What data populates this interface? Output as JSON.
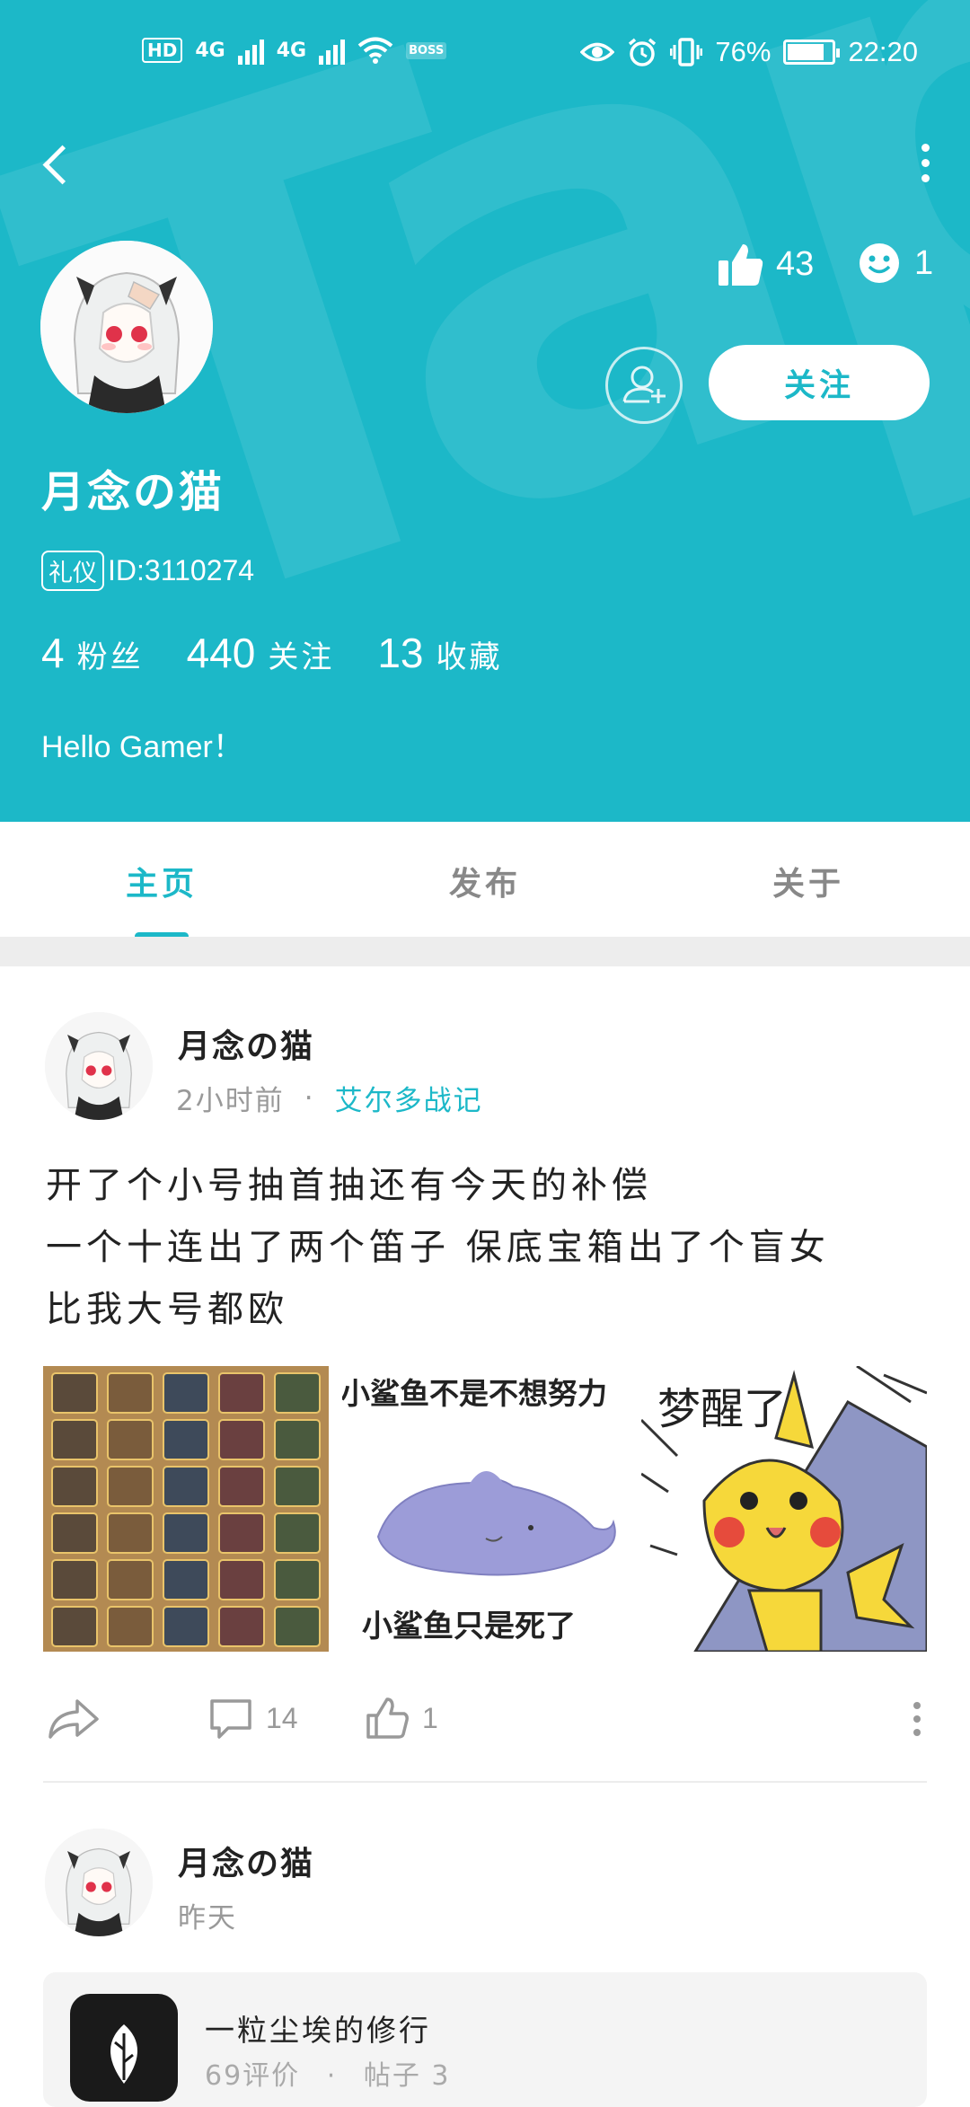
{
  "status_bar": {
    "left_badges": [
      "HD",
      "4G",
      "4G",
      "BOSS"
    ],
    "battery": "76%",
    "time": "22:20"
  },
  "profile": {
    "likes": "43",
    "smiles": "1",
    "follow_label": "关注",
    "username": "月念の猫",
    "tag": "礼仪",
    "id_text": "ID:3110274",
    "stats": [
      {
        "value": "4",
        "label": "粉丝"
      },
      {
        "value": "440",
        "label": "关注"
      },
      {
        "value": "13",
        "label": "收藏"
      }
    ],
    "bio": "Hello Gamer！"
  },
  "tabs": [
    {
      "label": "主页",
      "active": true
    },
    {
      "label": "发布",
      "active": false
    },
    {
      "label": "关于",
      "active": false
    }
  ],
  "posts": [
    {
      "author": "月念の猫",
      "time": "2小时前",
      "dot": "·",
      "game": "艾尔多战记",
      "lines": [
        "开了个小号抽首抽还有今天的补偿",
        "一个十连出了两个笛子 保底宝箱出了个盲女",
        "比我大号都欧"
      ],
      "image_captions": {
        "img2_top": "小鲨鱼不是不想努力",
        "img2_bottom": "小鲨鱼只是死了",
        "img3_top": "梦醒了"
      },
      "comments": "14",
      "likes": "1"
    },
    {
      "author": "月念の猫",
      "time": "昨天",
      "card": {
        "name": "一粒尘埃的修行",
        "sub_left": "69评价",
        "sub_dot": "·",
        "sub_right": "帖子 3"
      }
    }
  ],
  "colors": {
    "brand": "#1cb8c8",
    "band": "#ededed"
  }
}
